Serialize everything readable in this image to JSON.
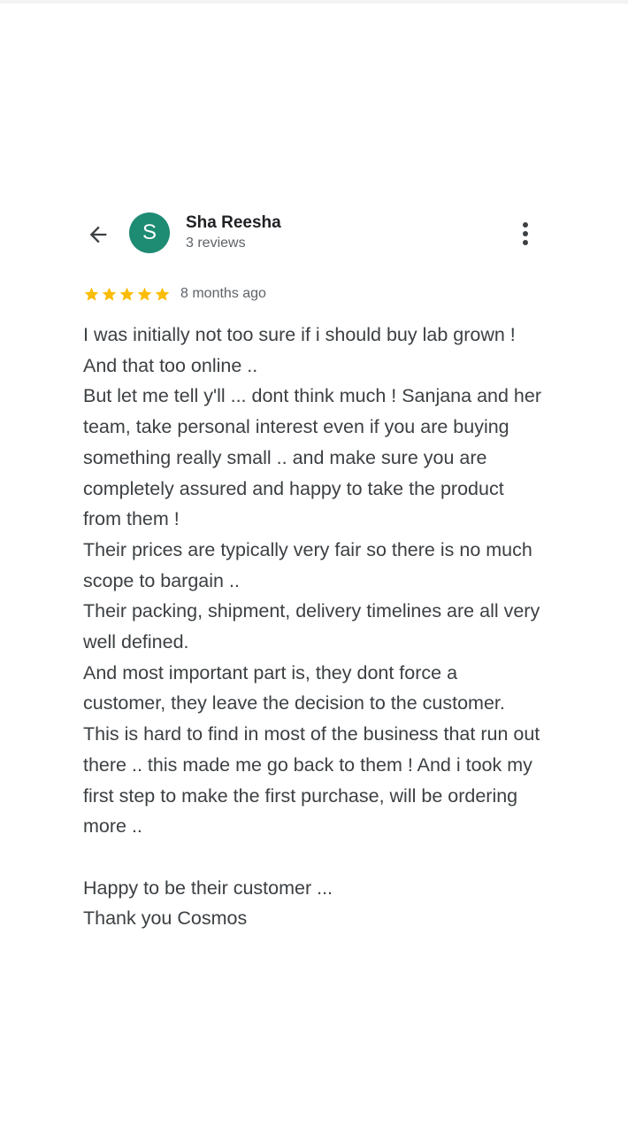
{
  "review": {
    "reviewer_name": "Sha Reesha",
    "review_count": "3 reviews",
    "avatar_initial": "S",
    "avatar_color": "#1e8b73",
    "rating": 5,
    "rating_max": 5,
    "star_color": "#fbbc04",
    "time_ago": "8 months ago",
    "text": "I was initially not too sure if i should buy lab grown ! And that too online ..\nBut let me tell y'll ... dont think much ! Sanjana and her team, take personal interest even if you are buying something really small .. and make sure you are completely assured and happy to take the product from them !\nTheir prices are typically very fair so there is no much scope to bargain ..\nTheir packing, shipment, delivery timelines are all very well defined.\nAnd most important part is, they dont force a customer, they leave the decision to the customer. This is hard to find in most of the business that run out there .. this made me go back to them ! And i took my first step to make the first purchase, will be ordering more ..\n\nHappy to be their customer ...\nThank you Cosmos"
  },
  "icons": {
    "back": "arrow-back-icon",
    "more": "more-vertical-icon",
    "star": "star-icon"
  }
}
